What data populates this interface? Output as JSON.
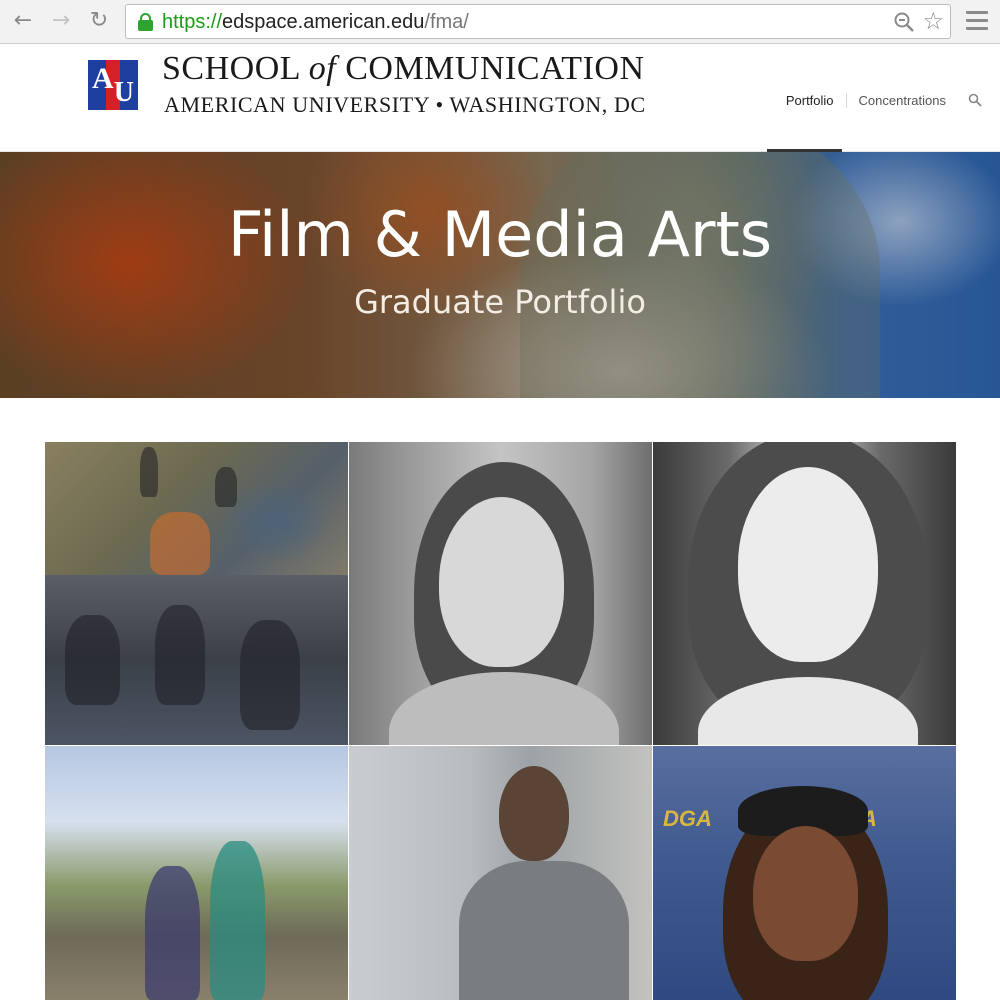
{
  "browser": {
    "url_scheme": "https://",
    "url_host": "edspace.american.edu",
    "url_path": "/fma/"
  },
  "site": {
    "logo_letters_a": "A",
    "logo_letters_u": "U",
    "title_school": "SCHOOL",
    "title_of": "of",
    "title_communication": "COMMUNICATION",
    "subtitle": "AMERICAN UNIVERSITY • WASHINGTON, DC",
    "nav": [
      {
        "label": "Portfolio"
      },
      {
        "label": "Concentrations"
      }
    ]
  },
  "hero": {
    "title": "Film & Media Arts",
    "subtitle": "Graduate Portfolio"
  },
  "grid": {
    "dga_text": "DGA"
  },
  "colors": {
    "secure_green": "#2fa32f",
    "au_blue": "#1e3fa0",
    "au_red": "#d52027"
  }
}
